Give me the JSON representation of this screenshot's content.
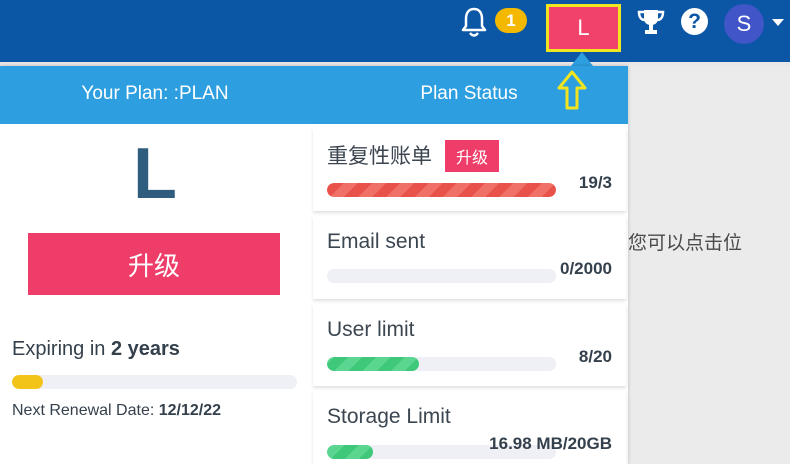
{
  "topbar": {
    "notification_count": "1",
    "selected_avatar_letter": "L",
    "user_initial": "S"
  },
  "background": {
    "text": "您可以点击位"
  },
  "panel": {
    "header": {
      "plan_label": "Your Plan: :PLAN",
      "status_label": "Plan Status"
    },
    "plan_letter": "L",
    "upgrade_label": "升级",
    "expiring_prefix": "Expiring in ",
    "expiring_value": "2 years",
    "expiring_progress": 0.11,
    "renewal_prefix": "Next Renewal Date: ",
    "renewal_value": "12/12/22",
    "status_items": [
      {
        "label": "重复性账单",
        "badge": "升级",
        "value": "19/3",
        "progress": 1.0,
        "color": "red"
      },
      {
        "label": "Email sent",
        "value": "0/2000",
        "progress": 0.0,
        "color": "green"
      },
      {
        "label": "User limit",
        "value": "8/20",
        "progress": 0.4,
        "color": "green"
      },
      {
        "label": "Storage Limit",
        "value": "16.98 MB/20GB",
        "progress": 0.2,
        "color": "green"
      }
    ]
  },
  "colors": {
    "topbar": "#0b57a6",
    "panel_header": "#2d9fe0",
    "accent_pink": "#ee3d68",
    "highlight_yellow": "#f1e521"
  }
}
